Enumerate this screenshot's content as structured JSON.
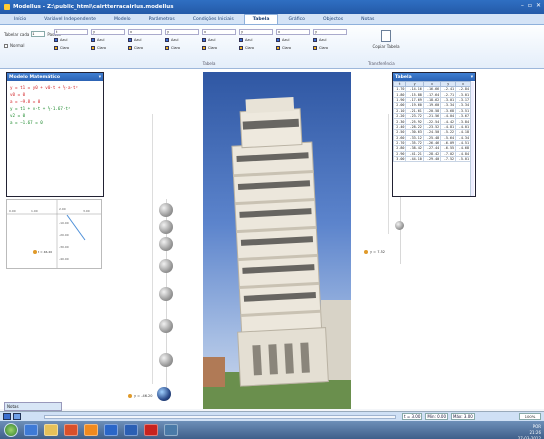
{
  "window": {
    "title": "Modellus - Z:\\public_html\\cairtterracairlus.modellus",
    "min_glyph": "–",
    "max_glyph": "▫",
    "close_glyph": "✕"
  },
  "ribbon_tabs": [
    "Início",
    "Variável Independente",
    "Modelo",
    "Parâmetros",
    "Condições Iniciais",
    "Tabela",
    "Gráfico",
    "Objectos",
    "Notas"
  ],
  "ribbon": {
    "tabela_value_label": "Tabelar cada",
    "tabela_value": "1",
    "passos_label": "Passos",
    "normal_label": "Normal",
    "column_selectors": [
      "t",
      "y",
      "v",
      "y",
      "v",
      "y",
      "v",
      "y"
    ],
    "axis_label": "Azul",
    "color_label": "Claro",
    "group_label": "Tabela",
    "copy_label": "Copiar Tabela",
    "transfer_label": "Transferência"
  },
  "model_panel": {
    "title": "Modelo Matemático",
    "equations": [
      {
        "text": "y = t1 = y0 + v0·t + ½·a·t²",
        "color": "red"
      },
      {
        "text": "v0 = 0",
        "color": "red"
      },
      {
        "text": "a = −9.8 = 0",
        "color": "red"
      },
      {
        "text": "y = t1 + v·t + ½·1.67·t²",
        "color": "grn"
      },
      {
        "text": "v2 = 0",
        "color": "grn"
      },
      {
        "text": "a = −1.67 = 0",
        "color": "grn"
      }
    ]
  },
  "graph": {
    "x_ticks": [
      "0.00",
      "1.00",
      "2.00",
      "3.00"
    ],
    "y_ticks": [
      "-10.00",
      "-20.00",
      "-30.00",
      "-40.00"
    ],
    "marker_label": "t = 46.20"
  },
  "table_panel": {
    "title": "Tabela",
    "headers": [
      "t",
      "y",
      "v",
      "y",
      "v"
    ],
    "rows": [
      [
        "1.70",
        "-14.16",
        "-16.66",
        "-2.41",
        "-2.84"
      ],
      [
        "1.80",
        "-15.88",
        "-17.64",
        "-2.71",
        "-3.01"
      ],
      [
        "1.90",
        "-17.69",
        "-18.62",
        "-3.01",
        "-3.17"
      ],
      [
        "2.00",
        "-19.60",
        "-19.60",
        "-3.34",
        "-3.34"
      ],
      [
        "2.10",
        "-21.61",
        "-20.58",
        "-3.68",
        "-3.51"
      ],
      [
        "2.20",
        "-23.72",
        "-21.56",
        "-4.04",
        "-3.67"
      ],
      [
        "2.30",
        "-25.92",
        "-22.54",
        "-4.42",
        "-3.84"
      ],
      [
        "2.40",
        "-28.22",
        "-23.52",
        "-4.81",
        "-4.01"
      ],
      [
        "2.50",
        "-30.63",
        "-24.50",
        "-5.22",
        "-4.18"
      ],
      [
        "2.60",
        "-33.12",
        "-25.48",
        "-5.64",
        "-4.34"
      ],
      [
        "2.70",
        "-35.72",
        "-26.46",
        "-6.09",
        "-4.51"
      ],
      [
        "2.80",
        "-38.42",
        "-27.44",
        "-6.55",
        "-4.68"
      ],
      [
        "2.90",
        "-41.21",
        "-28.42",
        "-7.02",
        "-4.84"
      ],
      [
        "3.00",
        "-44.10",
        "-29.40",
        "-7.52",
        "-5.01"
      ]
    ]
  },
  "scene": {
    "ball_label_left": "y = -46.20",
    "ball_label_right": "y = 7.52",
    "ball_label_mid": "y = -44.10"
  },
  "notes_tab": "Notas",
  "controls": {
    "t_readout": "t = 3.00",
    "min_label": "Min: 0.00",
    "max_label": "Máx: 3.00",
    "zoom": "100%"
  },
  "tray": {
    "time": "21:26",
    "date": "27-03-2012",
    "lang": "POR"
  }
}
